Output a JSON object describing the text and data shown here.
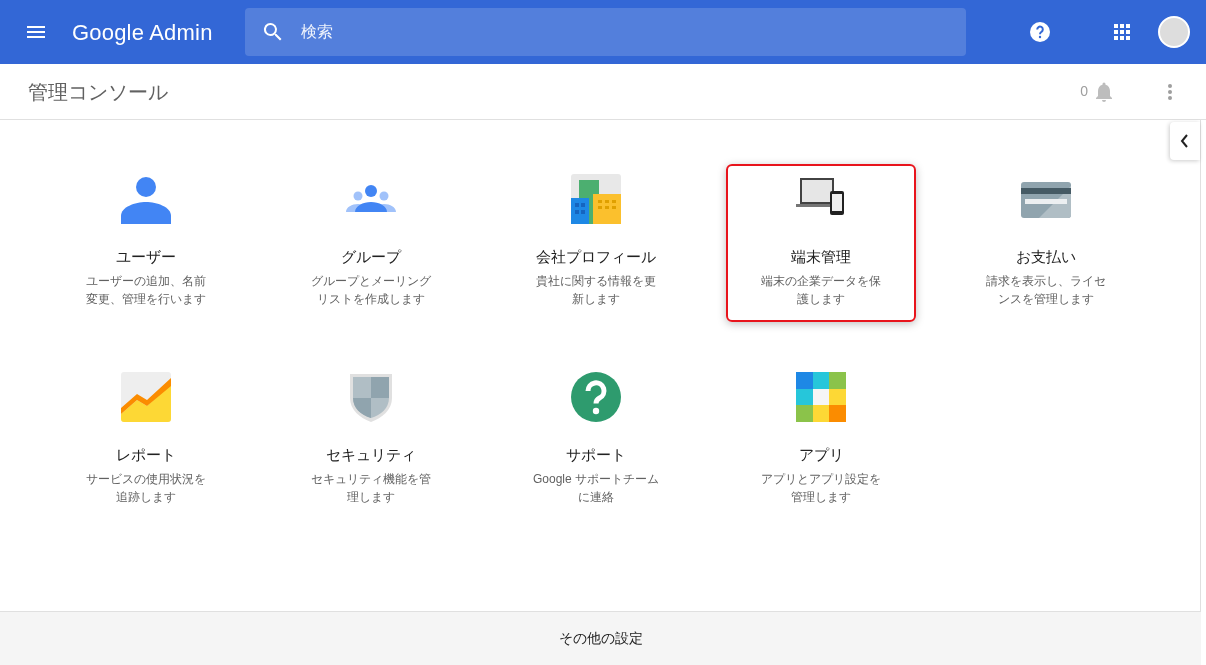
{
  "header": {
    "app_name": "Google Admin",
    "search": {
      "placeholder": "検索"
    }
  },
  "subheader": {
    "title": "管理コンソール",
    "notification_count": "0"
  },
  "tiles": [
    {
      "kind": "user",
      "title": "ユーザー",
      "description": [
        "ユーザーの追加、名前",
        "変更、管理を行います"
      ],
      "highlighted": false
    },
    {
      "kind": "group",
      "title": "グループ",
      "description": [
        "グループとメーリング",
        "リストを作成します"
      ],
      "highlighted": false
    },
    {
      "kind": "company",
      "title": "会社プロフィール",
      "description": [
        "貴社に関する情報を更",
        "新します"
      ],
      "highlighted": false
    },
    {
      "kind": "devices",
      "title": "端末管理",
      "description": [
        "端末の企業データを保",
        "護します"
      ],
      "highlighted": true
    },
    {
      "kind": "billing",
      "title": "お支払い",
      "description": [
        "請求を表示し、ライセ",
        "ンスを管理します"
      ],
      "highlighted": false
    },
    {
      "kind": "reports",
      "title": "レポート",
      "description": [
        "サービスの使用状況を",
        "追跡します"
      ],
      "highlighted": false
    },
    {
      "kind": "security",
      "title": "セキュリティ",
      "description": [
        "セキュリティ機能を管",
        "理します"
      ],
      "highlighted": false
    },
    {
      "kind": "support",
      "title": "サポート",
      "description": [
        "Google サポートチーム",
        "に連絡"
      ],
      "highlighted": false
    },
    {
      "kind": "apps",
      "title": "アプリ",
      "description": [
        "アプリとアプリ設定を",
        "管理します"
      ],
      "highlighted": false
    }
  ],
  "footer": {
    "link": "その他の設定"
  }
}
